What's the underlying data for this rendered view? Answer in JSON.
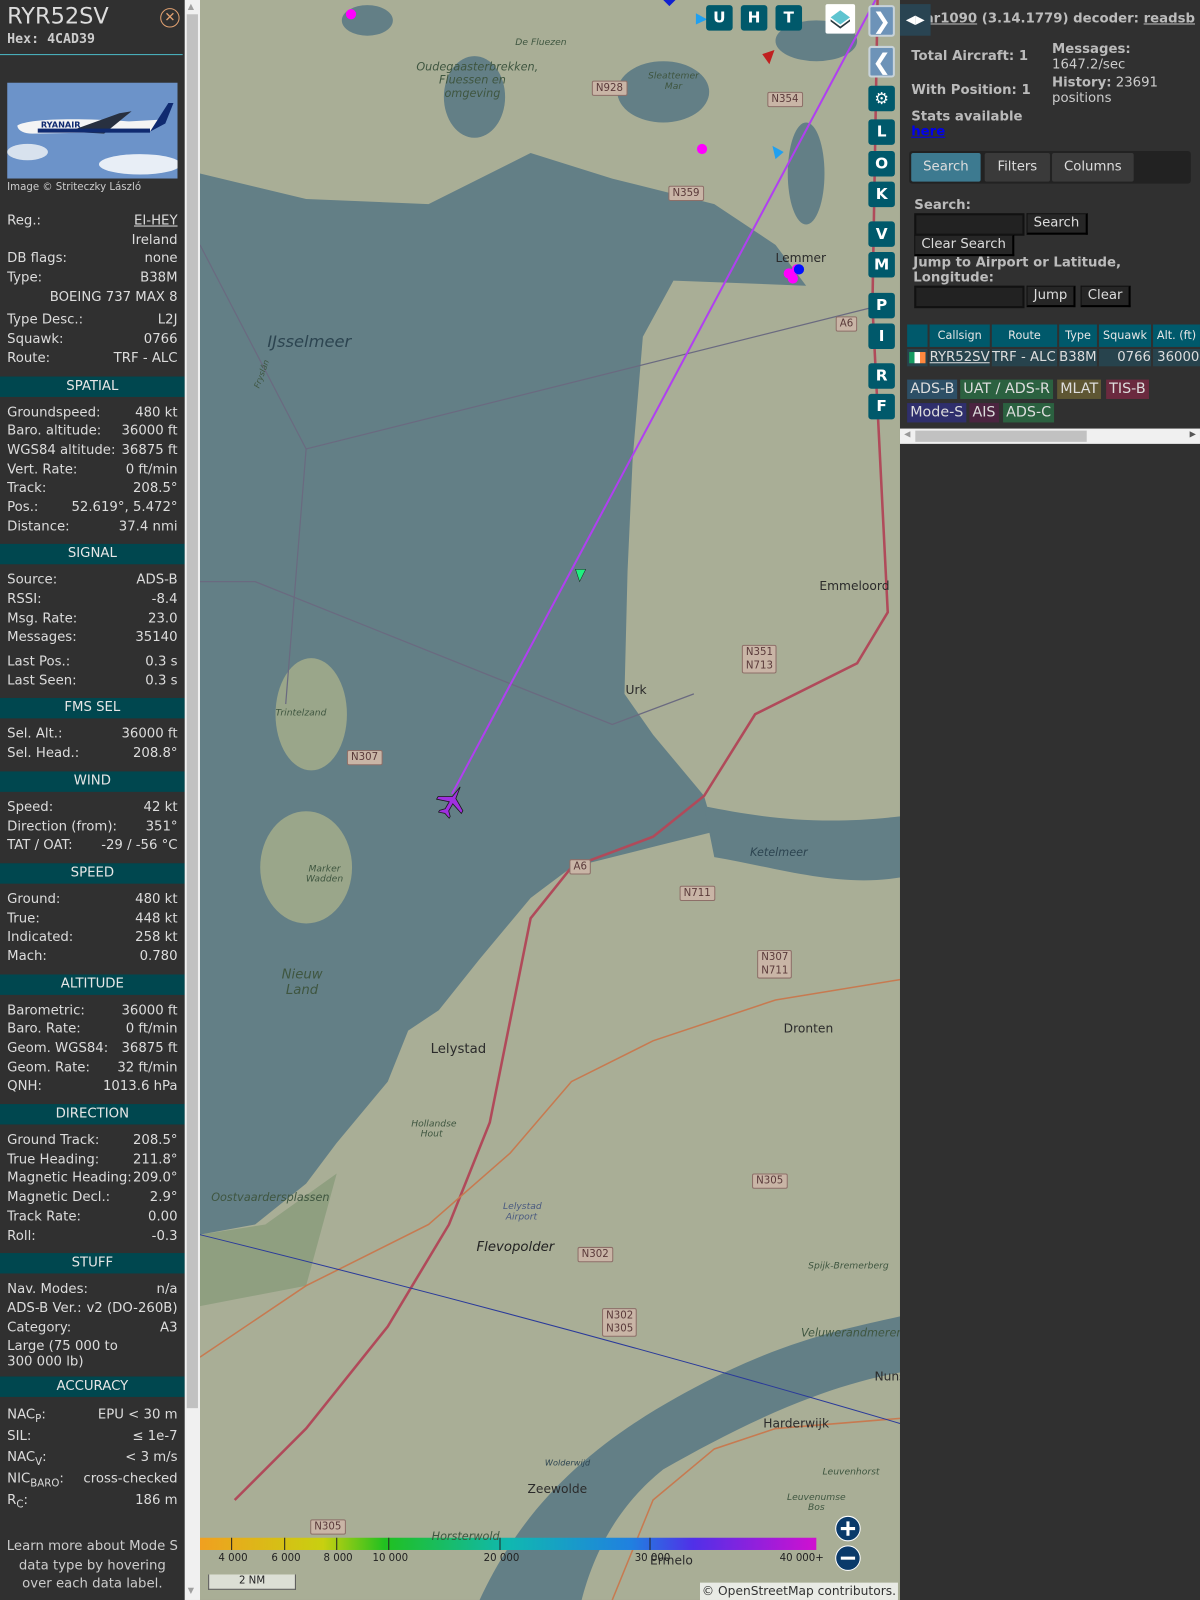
{
  "aircraft": {
    "callsign": "RYR52SV",
    "hex": "Hex: 4CAD39",
    "photo_credit": "Image © Striteczky László",
    "photo_logo_text": "RYANAIR",
    "info": [
      {
        "label": "Reg.:",
        "value": "EI-HEY"
      },
      {
        "label": "",
        "value": "Ireland"
      },
      {
        "label": "DB flags:",
        "value": "none"
      },
      {
        "label": "Type:",
        "value": "B38M"
      },
      {
        "label": "",
        "value": "BOEING 737 MAX 8"
      },
      {
        "label": "Type Desc.:",
        "value": "L2J"
      },
      {
        "label": "Squawk:",
        "value": "0766"
      },
      {
        "label": "Route:",
        "value": "TRF - ALC"
      }
    ],
    "sections": {
      "spatial": {
        "title": "SPATIAL",
        "rows": [
          {
            "label": "Groundspeed:",
            "value": "480 kt"
          },
          {
            "label": "Baro. altitude:",
            "value": "36000 ft"
          },
          {
            "label": "WGS84 altitude:",
            "value": "36875 ft"
          },
          {
            "label": "Vert. Rate:",
            "value": "0 ft/min"
          },
          {
            "label": "Track:",
            "value": "208.5°"
          },
          {
            "label": "Pos.:",
            "value": "52.619°, 5.472°"
          },
          {
            "label": "Distance:",
            "value": "37.4 nmi"
          }
        ]
      },
      "signal": {
        "title": "SIGNAL",
        "rows": [
          {
            "label": "Source:",
            "value": "ADS-B"
          },
          {
            "label": "RSSI:",
            "value": "-8.4"
          },
          {
            "label": "Msg. Rate:",
            "value": "23.0"
          },
          {
            "label": "Messages:",
            "value": "35140"
          },
          {
            "label": "Last Pos.:",
            "value": "0.3 s"
          },
          {
            "label": "Last Seen:",
            "value": "0.3 s"
          }
        ]
      },
      "fms": {
        "title": "FMS SEL",
        "rows": [
          {
            "label": "Sel. Alt.:",
            "value": "36000 ft"
          },
          {
            "label": "Sel. Head.:",
            "value": "208.8°"
          }
        ]
      },
      "wind": {
        "title": "WIND",
        "rows": [
          {
            "label": "Speed:",
            "value": "42 kt"
          },
          {
            "label": "Direction (from):",
            "value": "351°"
          },
          {
            "label": "TAT / OAT:",
            "value": "-29 / -56 °C"
          }
        ]
      },
      "speed": {
        "title": "SPEED",
        "rows": [
          {
            "label": "Ground:",
            "value": "480 kt"
          },
          {
            "label": "True:",
            "value": "448 kt"
          },
          {
            "label": "Indicated:",
            "value": "258 kt"
          },
          {
            "label": "Mach:",
            "value": "0.780"
          }
        ]
      },
      "altitude": {
        "title": "ALTITUDE",
        "rows": [
          {
            "label": "Barometric:",
            "value": "36000 ft"
          },
          {
            "label": "Baro. Rate:",
            "value": "0 ft/min"
          },
          {
            "label": "Geom. WGS84:",
            "value": "36875 ft"
          },
          {
            "label": "Geom. Rate:",
            "value": "32 ft/min"
          },
          {
            "label": "QNH:",
            "value": "1013.6 hPa"
          }
        ]
      },
      "direction": {
        "title": "DIRECTION",
        "rows": [
          {
            "label": "Ground Track:",
            "value": "208.5°"
          },
          {
            "label": "True Heading:",
            "value": "211.8°"
          },
          {
            "label": "Magnetic Heading:",
            "value": "209.0°"
          },
          {
            "label": "Magnetic Decl.:",
            "value": "2.9°"
          },
          {
            "label": "Track Rate:",
            "value": "0.00"
          },
          {
            "label": "Roll:",
            "value": "-0.3"
          }
        ]
      },
      "stuff": {
        "title": "STUFF",
        "rows": [
          {
            "label": "Nav. Modes:",
            "value": "n/a"
          },
          {
            "label": "ADS-B Ver.:",
            "value": "v2 (DO-260B)"
          },
          {
            "label": "Category:",
            "value": "A3"
          }
        ],
        "category_desc": "Large (75 000 to 300 000 lb)"
      },
      "accuracy": {
        "title": "ACCURACY",
        "rows": [
          {
            "label": "NAC",
            "sub": "P",
            "value": "EPU < 30 m"
          },
          {
            "label": "SIL",
            "sub": "",
            "value": "≤ 1e-7"
          },
          {
            "label": "NAC",
            "sub": "V",
            "value": "< 3 m/s"
          },
          {
            "label": "NIC",
            "sub": "BARO",
            "value": "cross-checked"
          },
          {
            "label": "R",
            "sub": "C",
            "value": "186 m"
          }
        ]
      }
    },
    "footer": "Learn more about Mode S data type by hovering over each data label."
  },
  "map": {
    "top_buttons": [
      "U",
      "H",
      "T"
    ],
    "side_buttons": [
      "L",
      "O",
      "K",
      "V",
      "M",
      "P",
      "I",
      "R",
      "F"
    ],
    "labels": {
      "ijsselmeer": "IJsselmeer",
      "oudega": "Oudegaasterbrekken, Fluessen en omgeving",
      "fluezen": "De Fluezen",
      "sleattemer": "Sleattemer Mar",
      "lemmer": "Lemmer",
      "emmeloord": "Emmeloord",
      "urk": "Urk",
      "trintelzand": "Trintelzand",
      "marker": "Marker Wadden",
      "nieuwland": "Nieuw Land",
      "ketelmeer": "Ketelmeer",
      "lelystad": "Lelystad",
      "dronten": "Dronten",
      "hollandse": "Hollandse Hout",
      "oostvaarders": "Oostvaardersplassen",
      "airport": "Lelystad Airport",
      "flevopolder": "Flevopolder",
      "spijk": "Spijk-Bremerberg",
      "veluwe": "Veluwerandmeren",
      "harderwijk": "Harderwijk",
      "zeewolde": "Zeewolde",
      "leuvenhorst": "Leuvenhorst",
      "leuvenumse": "Leuvenumse Bos",
      "horsterwold": "Horsterwold",
      "ermelo": "Ermelo",
      "nunspeet": "Nuns",
      "wolderwijd": "Wolderwijd",
      "frysian": "Fryslân"
    },
    "shields": [
      "N928",
      "N354",
      "N359",
      "A6",
      "N351 N713",
      "N307",
      "A6",
      "N711",
      "N307 N711",
      "N305",
      "N302",
      "N302 N305",
      "N305"
    ],
    "altitude_legend": {
      "ticks": [
        "4 000",
        "6 000",
        "8 000",
        "10 000",
        "20 000",
        "30 000",
        "40 000+"
      ]
    },
    "scale": "2 NM",
    "attribution": "© OpenStreetMap contributors."
  },
  "stats": {
    "app": "tar1090",
    "version": "(3.14.1779) decoder:",
    "decoder": "readsb",
    "total_aircraft": "Total Aircraft: 1",
    "with_position": "With Position: 1",
    "messages_label": "Messages:",
    "messages_value": "1647.2/sec",
    "history_label": "History:",
    "history_value": "23691 positions",
    "stats_label": "Stats available",
    "stats_link": "here"
  },
  "tabs": [
    "Search",
    "Filters",
    "Columns"
  ],
  "search": {
    "search_label": "Search:",
    "search_value": "",
    "search_button": "Search",
    "clear_search_button": "Clear Search",
    "jump_label": "Jump to Airport or Latitude, Longitude:",
    "jump_value": "",
    "jump_button": "Jump",
    "clear_button": "Clear"
  },
  "table": {
    "columns": [
      "",
      "Callsign",
      "Route",
      "Type",
      "Squawk",
      "Alt. (ft)"
    ],
    "rows": [
      {
        "callsign": "RYR52SV",
        "route": "TRF - ALC",
        "type": "B38M",
        "squawk": "0766",
        "alt": "36000"
      }
    ]
  },
  "legend": [
    {
      "label": "ADS-B",
      "color": "#2d4f66"
    },
    {
      "label": "UAT / ADS-R",
      "color": "#2b6140"
    },
    {
      "label": "MLAT",
      "color": "#5e5633"
    },
    {
      "label": "TIS-B",
      "color": "#6b2a3f"
    },
    {
      "label": "Mode-S",
      "color": "#2f2f6c"
    },
    {
      "label": "AIS",
      "color": "#4b2440"
    },
    {
      "label": "ADS-C",
      "color": "#2b6140"
    }
  ]
}
